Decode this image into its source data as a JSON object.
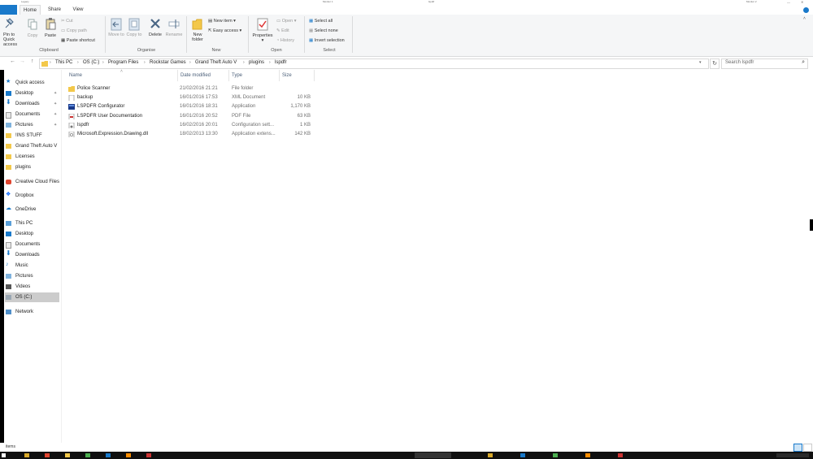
{
  "window": {
    "title_left": "Legacy",
    "title_mid1": "Monitor 1",
    "title_mid2": "lspdfr",
    "title_right": "Monitor 2"
  },
  "tabs": [
    {
      "label": "Home"
    },
    {
      "label": "Share"
    },
    {
      "label": "View"
    }
  ],
  "ribbon": {
    "pin_label": "Pin to Quick access",
    "copy": "Copy",
    "paste": "Paste",
    "cut": "Cut",
    "copy_path": "Copy path",
    "paste_shortcut": "Paste shortcut",
    "clipboard_group": "Clipboard",
    "move_to": "Move to",
    "copy_to": "Copy to",
    "delete": "Delete",
    "rename": "Rename",
    "organise_group": "Organise",
    "new_folder": "New folder",
    "new_item": "New item",
    "easy_access": "Easy access",
    "new_group": "New",
    "properties": "Properties",
    "open": "Open",
    "edit": "Edit",
    "history": "History",
    "open_group": "Open",
    "select_all": "Select all",
    "select_none": "Select none",
    "invert_selection": "Invert selection",
    "select_group": "Select"
  },
  "address": {
    "breadcrumbs": [
      "This PC",
      "OS (C:)",
      "Program Files",
      "Rockstar Games",
      "Grand Theft Auto V",
      "plugins",
      "lspdfr"
    ],
    "search_placeholder": "Search lspdfr"
  },
  "nav": {
    "quick_access": "Quick access",
    "quick_items": [
      "Desktop",
      "Downloads",
      "Documents",
      "Pictures",
      "!INS STUFF",
      "Grand Theft Auto V",
      "Licenses",
      "plugins"
    ],
    "creative_cloud": "Creative Cloud Files",
    "dropbox": "Dropbox",
    "onedrive": "OneDrive",
    "this_pc": "This PC",
    "pc_items": [
      "Desktop",
      "Documents",
      "Downloads",
      "Music",
      "Pictures",
      "Videos",
      "OS (C:)"
    ],
    "network": "Network"
  },
  "columns": {
    "name": "Name",
    "date": "Date modified",
    "type": "Type",
    "size": "Size"
  },
  "files": [
    {
      "name": "Police Scanner",
      "date": "21/02/2016 21:21",
      "type": "File folder",
      "size": "",
      "icon": "folder-icon"
    },
    {
      "name": "backup",
      "date": "16/01/2016 17:53",
      "type": "XML Document",
      "size": "10 KB",
      "icon": "xml-file-icon"
    },
    {
      "name": "LSPDFR Configurator",
      "date": "16/01/2016 18:31",
      "type": "Application",
      "size": "1,170 KB",
      "icon": "app-icon"
    },
    {
      "name": "LSPDFR User Documentation",
      "date": "16/01/2016 20:52",
      "type": "PDF File",
      "size": "63 KB",
      "icon": "pdf-file-icon"
    },
    {
      "name": "lspdfr",
      "date": "16/02/2016 20:01",
      "type": "Configuration sett...",
      "size": "1 KB",
      "icon": "config-file-icon"
    },
    {
      "name": "Microsoft.Expression.Drawing.dll",
      "date": "18/02/2013 13:30",
      "type": "Application extens...",
      "size": "142 KB",
      "icon": "dll-file-icon"
    }
  ],
  "status": {
    "items_text": "items"
  },
  "colors": {
    "accent": "#1979ca",
    "folder": "#f3c84a",
    "selected_nav": "#cccccc"
  }
}
